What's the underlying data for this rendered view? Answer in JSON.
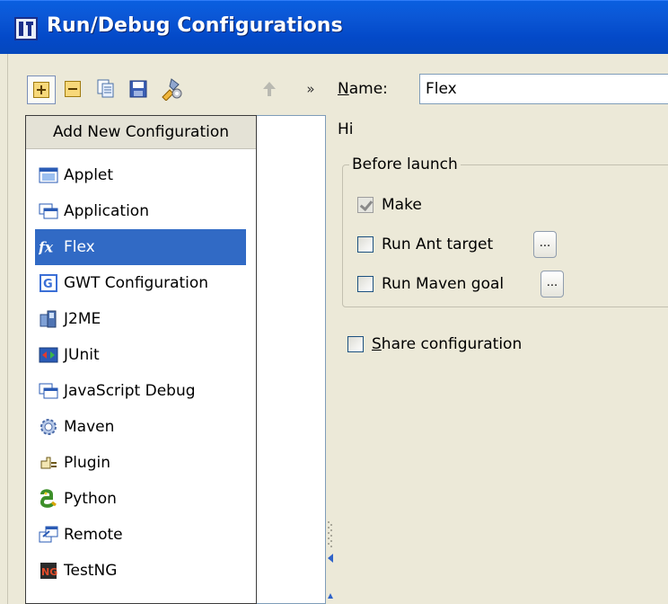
{
  "window": {
    "title": "Run/Debug Configurations"
  },
  "toolbar": {
    "buttons": [
      "add-icon",
      "remove-icon",
      "copy-icon",
      "save-icon",
      "edit-defaults-icon",
      "move-up-icon",
      "more-icon"
    ],
    "more_label": "»"
  },
  "form": {
    "name_label_prefix": "N",
    "name_label_rest": "ame:",
    "name_value": "Flex",
    "description": "Hi"
  },
  "before_launch": {
    "title": "Before launch",
    "options": [
      {
        "label": "Make",
        "checked": true
      },
      {
        "label": "Run Ant target",
        "checked": false,
        "has_button": true
      },
      {
        "label": "Run Maven goal",
        "checked": false,
        "has_button": true
      }
    ],
    "button_label": "..."
  },
  "share": {
    "label_prefix": "S",
    "label_rest": "hare configuration",
    "checked": false
  },
  "popup": {
    "header": "Add New Configuration",
    "items": [
      {
        "label": "Applet",
        "icon": "applet-icon"
      },
      {
        "label": "Application",
        "icon": "application-icon"
      },
      {
        "label": "Flex",
        "icon": "flex-icon",
        "selected": true
      },
      {
        "label": "GWT Configuration",
        "icon": "gwt-icon"
      },
      {
        "label": "J2ME",
        "icon": "j2me-icon"
      },
      {
        "label": "JUnit",
        "icon": "junit-icon"
      },
      {
        "label": "JavaScript Debug",
        "icon": "javascript-debug-icon"
      },
      {
        "label": "Maven",
        "icon": "maven-icon"
      },
      {
        "label": "Plugin",
        "icon": "plugin-icon"
      },
      {
        "label": "Python",
        "icon": "python-icon"
      },
      {
        "label": "Remote",
        "icon": "remote-icon"
      },
      {
        "label": "TestNG",
        "icon": "testng-icon"
      }
    ]
  },
  "colors": {
    "titlebar": "#0a5fe0",
    "selection": "#316ac5",
    "face": "#ece9d8"
  }
}
